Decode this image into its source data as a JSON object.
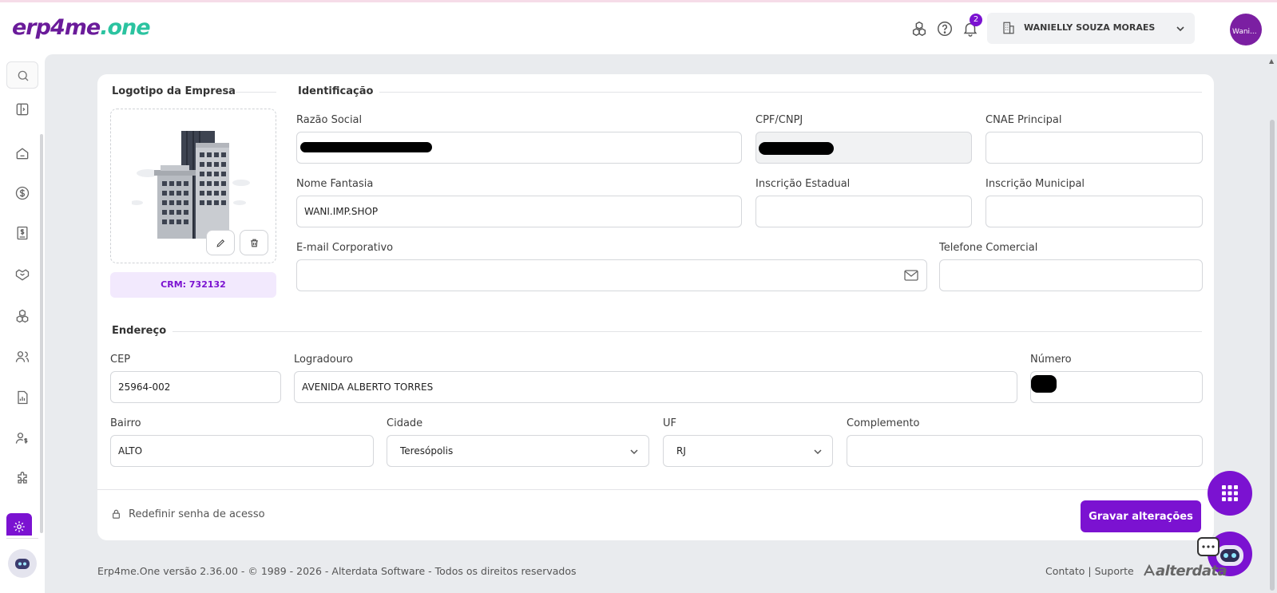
{
  "header": {
    "logo_part1": "erp4me",
    "logo_part2": ".one",
    "notification_count": "2",
    "company_name": "WANIELLY SOUZA MORAES",
    "avatar_alt": "Wani..."
  },
  "sidebar": {
    "icons": [
      "search-icon",
      "collapse-icon",
      "home-icon",
      "finance-icon",
      "invoice-icon",
      "handshake-icon",
      "modules-icon",
      "users-icon",
      "reports-icon",
      "payroll-icon",
      "extensions-icon",
      "settings-icon",
      "assistant-icon"
    ]
  },
  "logo_section": {
    "title": "Logotipo da Empresa",
    "crm_label": "CRM: 732132"
  },
  "identification": {
    "title": "Identificação",
    "razao_social_label": "Razão Social",
    "razao_social_value": "",
    "cpf_cnpj_label": "CPF/CNPJ",
    "cpf_cnpj_value": "",
    "cnae_label": "CNAE Principal",
    "cnae_value": "",
    "nome_fantasia_label": "Nome Fantasia",
    "nome_fantasia_value": "WANI.IMP.SHOP",
    "ie_label": "Inscrição Estadual",
    "ie_value": "",
    "im_label": "Inscrição Municipal",
    "im_value": "",
    "email_label": "E-mail Corporativo",
    "email_value": "",
    "phone_label": "Telefone Comercial",
    "phone_value": ""
  },
  "address": {
    "title": "Endereço",
    "cep_label": "CEP",
    "cep_value": "25964-002",
    "logradouro_label": "Logradouro",
    "logradouro_value": "AVENIDA ALBERTO TORRES",
    "numero_label": "Número",
    "numero_value": "",
    "bairro_label": "Bairro",
    "bairro_value": "ALTO",
    "cidade_label": "Cidade",
    "cidade_value": "Teresópolis",
    "uf_label": "UF",
    "uf_value": "RJ",
    "complemento_label": "Complemento",
    "complemento_value": ""
  },
  "actions": {
    "reset_password": "Redefinir senha de acesso",
    "save": "Gravar alterações"
  },
  "footer": {
    "copyright": "Erp4me.One versão 2.36.00 - © 1989 - 2026 - Alterdata Software - Todos os direitos reservados",
    "links": "Contato | Suporte",
    "brand": "alterdata"
  },
  "colors": {
    "accent": "#7b12d1",
    "logo_purple": "#6a1b9a",
    "logo_green": "#2bc3a0",
    "background": "#e9ebee"
  }
}
